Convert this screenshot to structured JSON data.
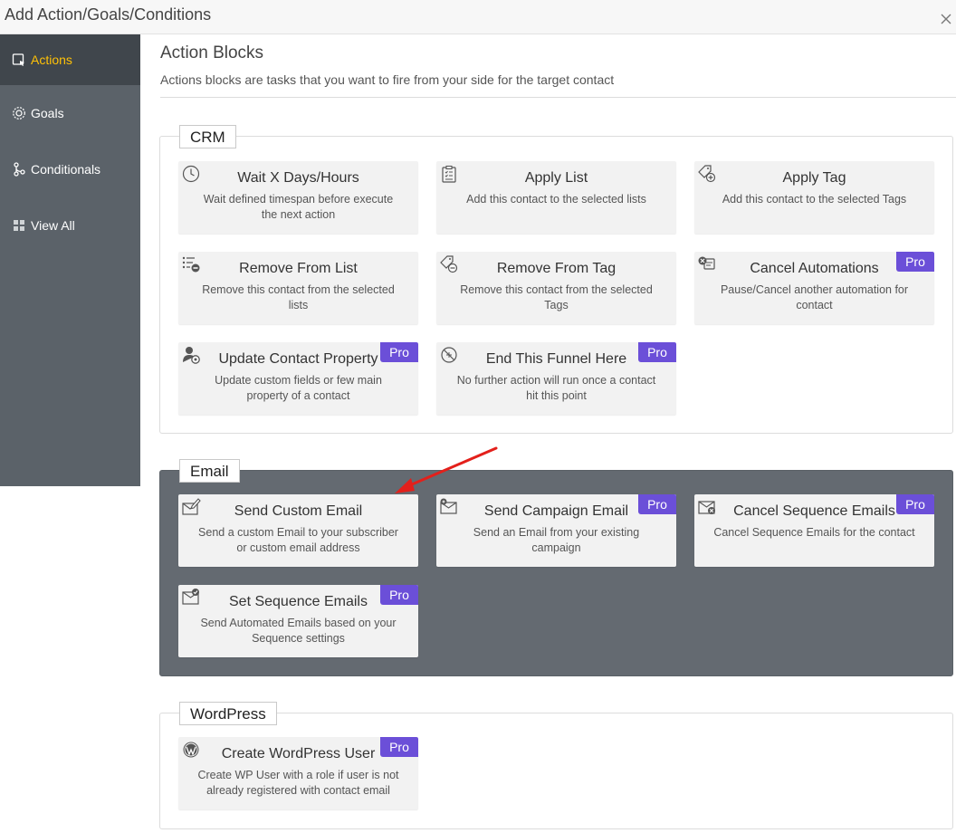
{
  "modal": {
    "title": "Add Action/Goals/Conditions"
  },
  "sidebar": {
    "items": [
      {
        "label": "Actions",
        "icon": "action-icon",
        "active": true
      },
      {
        "label": "Goals",
        "icon": "goal-icon",
        "active": false
      },
      {
        "label": "Conditionals",
        "icon": "conditional-icon",
        "active": false
      },
      {
        "label": "View All",
        "icon": "grid-icon",
        "active": false
      }
    ]
  },
  "main": {
    "title": "Action Blocks",
    "description": "Actions blocks are tasks that you want to fire from your side for the target contact"
  },
  "groups": {
    "crm": {
      "label": "CRM",
      "cards": [
        {
          "title": "Wait X Days/Hours",
          "desc": "Wait defined timespan before execute the next action",
          "icon": "clock-icon",
          "pro": ""
        },
        {
          "title": "Apply List",
          "desc": "Add this contact to the selected lists",
          "icon": "clipboard-list-icon",
          "pro": ""
        },
        {
          "title": "Apply Tag",
          "desc": "Add this contact to the selected Tags",
          "icon": "tag-plus-icon",
          "pro": ""
        },
        {
          "title": "Remove From List",
          "desc": "Remove this contact from the selected lists",
          "icon": "list-remove-icon",
          "pro": ""
        },
        {
          "title": "Remove From Tag",
          "desc": "Remove this contact from the selected Tags",
          "icon": "tag-remove-icon",
          "pro": ""
        },
        {
          "title": "Cancel Automations",
          "desc": "Pause/Cancel another automation for contact",
          "icon": "cancel-automation-icon",
          "pro": "Pro"
        },
        {
          "title": "Update Contact Property",
          "desc": "Update custom fields or few main property of a contact",
          "icon": "user-gear-icon",
          "pro": "Pro"
        },
        {
          "title": "End This Funnel Here",
          "desc": "No further action will run once a contact hit this point",
          "icon": "stop-circle-icon",
          "pro": "Pro"
        }
      ]
    },
    "email": {
      "label": "Email",
      "cards": [
        {
          "title": "Send Custom Email",
          "desc": "Send a custom Email to your subscriber or custom email address",
          "icon": "email-edit-icon",
          "pro": ""
        },
        {
          "title": "Send Campaign Email",
          "desc": "Send an Email from your existing campaign",
          "icon": "email-campaign-icon",
          "pro": "Pro"
        },
        {
          "title": "Cancel Sequence Emails",
          "desc": "Cancel Sequence Emails for the contact",
          "icon": "email-cancel-icon",
          "pro": "Pro"
        },
        {
          "title": "Set Sequence Emails",
          "desc": "Send Automated Emails based on your Sequence settings",
          "icon": "email-check-icon",
          "pro": "Pro"
        }
      ]
    },
    "wordpress": {
      "label": "WordPress",
      "cards": [
        {
          "title": "Create WordPress User",
          "desc": "Create WP User with a role if user is not already registered with contact email",
          "icon": "wordpress-icon",
          "pro": "Pro"
        }
      ]
    }
  },
  "colors": {
    "sidebar_bg": "#5b6269",
    "sidebar_active_bg": "#40464c",
    "sidebar_active_text": "#ffc107",
    "pro_badge": "#6b4fd8",
    "email_group_bg": "#646a71",
    "annotation_arrow": "#e3201b"
  }
}
